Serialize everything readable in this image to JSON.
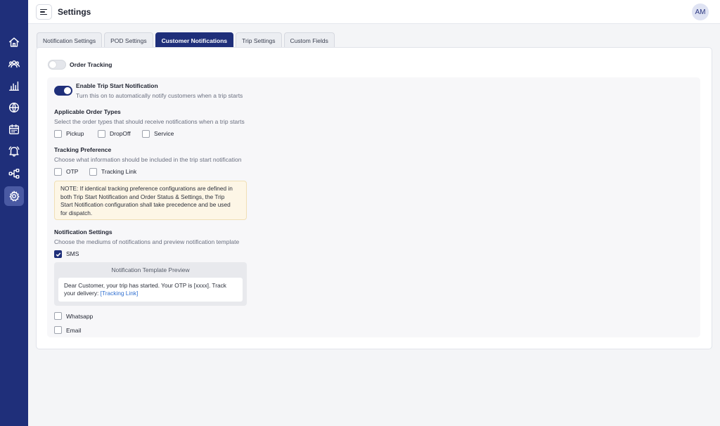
{
  "header": {
    "title": "Settings",
    "avatar_initials": "AM"
  },
  "sidebar": {
    "icons": [
      "home-icon",
      "users-icon",
      "bar-chart-icon",
      "globe-icon",
      "calendar-icon",
      "bell-icon",
      "workflow-icon",
      "gear-icon"
    ],
    "active": "gear-icon"
  },
  "tabs": [
    {
      "label": "Notification Settings",
      "active": false
    },
    {
      "label": "POD Settings",
      "active": false
    },
    {
      "label": "Customer Notifications",
      "active": true
    },
    {
      "label": "Trip Settings",
      "active": false
    },
    {
      "label": "Custom Fields",
      "active": false
    }
  ],
  "order_tracking": {
    "label": "Order Tracking",
    "enabled": false
  },
  "trip_start": {
    "title": "Enable Trip Start Notification",
    "description": "Turn this on to automatically notify customers when a trip starts",
    "enabled": true
  },
  "order_types": {
    "title": "Applicable Order Types",
    "description": "Select the order types that should receive notifications when a trip starts",
    "options": [
      {
        "label": "Pickup",
        "checked": false
      },
      {
        "label": "DropOff",
        "checked": false
      },
      {
        "label": "Service",
        "checked": false
      }
    ]
  },
  "tracking_preference": {
    "title": "Tracking Preference",
    "description": "Choose what information should be included in the trip start notification",
    "options": [
      {
        "label": "OTP",
        "checked": false
      },
      {
        "label": "Tracking Link",
        "checked": false
      }
    ],
    "note_lines": [
      "NOTE: If identical tracking preference configurations are defined in",
      "both Trip Start Notification and Order Status & Settings, the Trip",
      "Start Notification configuration shall take precedence and be used",
      "for dispatch."
    ]
  },
  "notification_settings": {
    "title": "Notification Settings",
    "description": "Choose the mediums of notifications and preview notification template",
    "sms": {
      "label": "SMS",
      "checked": true
    },
    "preview": {
      "title": "Notification Template Preview",
      "line1": "Dear Customer, your trip has started. Your OTP is [xxxx]. Track",
      "line2_prefix": "your delivery: ",
      "link_text": "[Tracking Link]"
    },
    "whatsapp": {
      "label": "Whatsapp",
      "checked": false
    },
    "email": {
      "label": "Email",
      "checked": false
    }
  },
  "colors": {
    "primary": "#1f2f7a",
    "note_bg": "#fdf6e6",
    "link": "#2f6fd0"
  }
}
